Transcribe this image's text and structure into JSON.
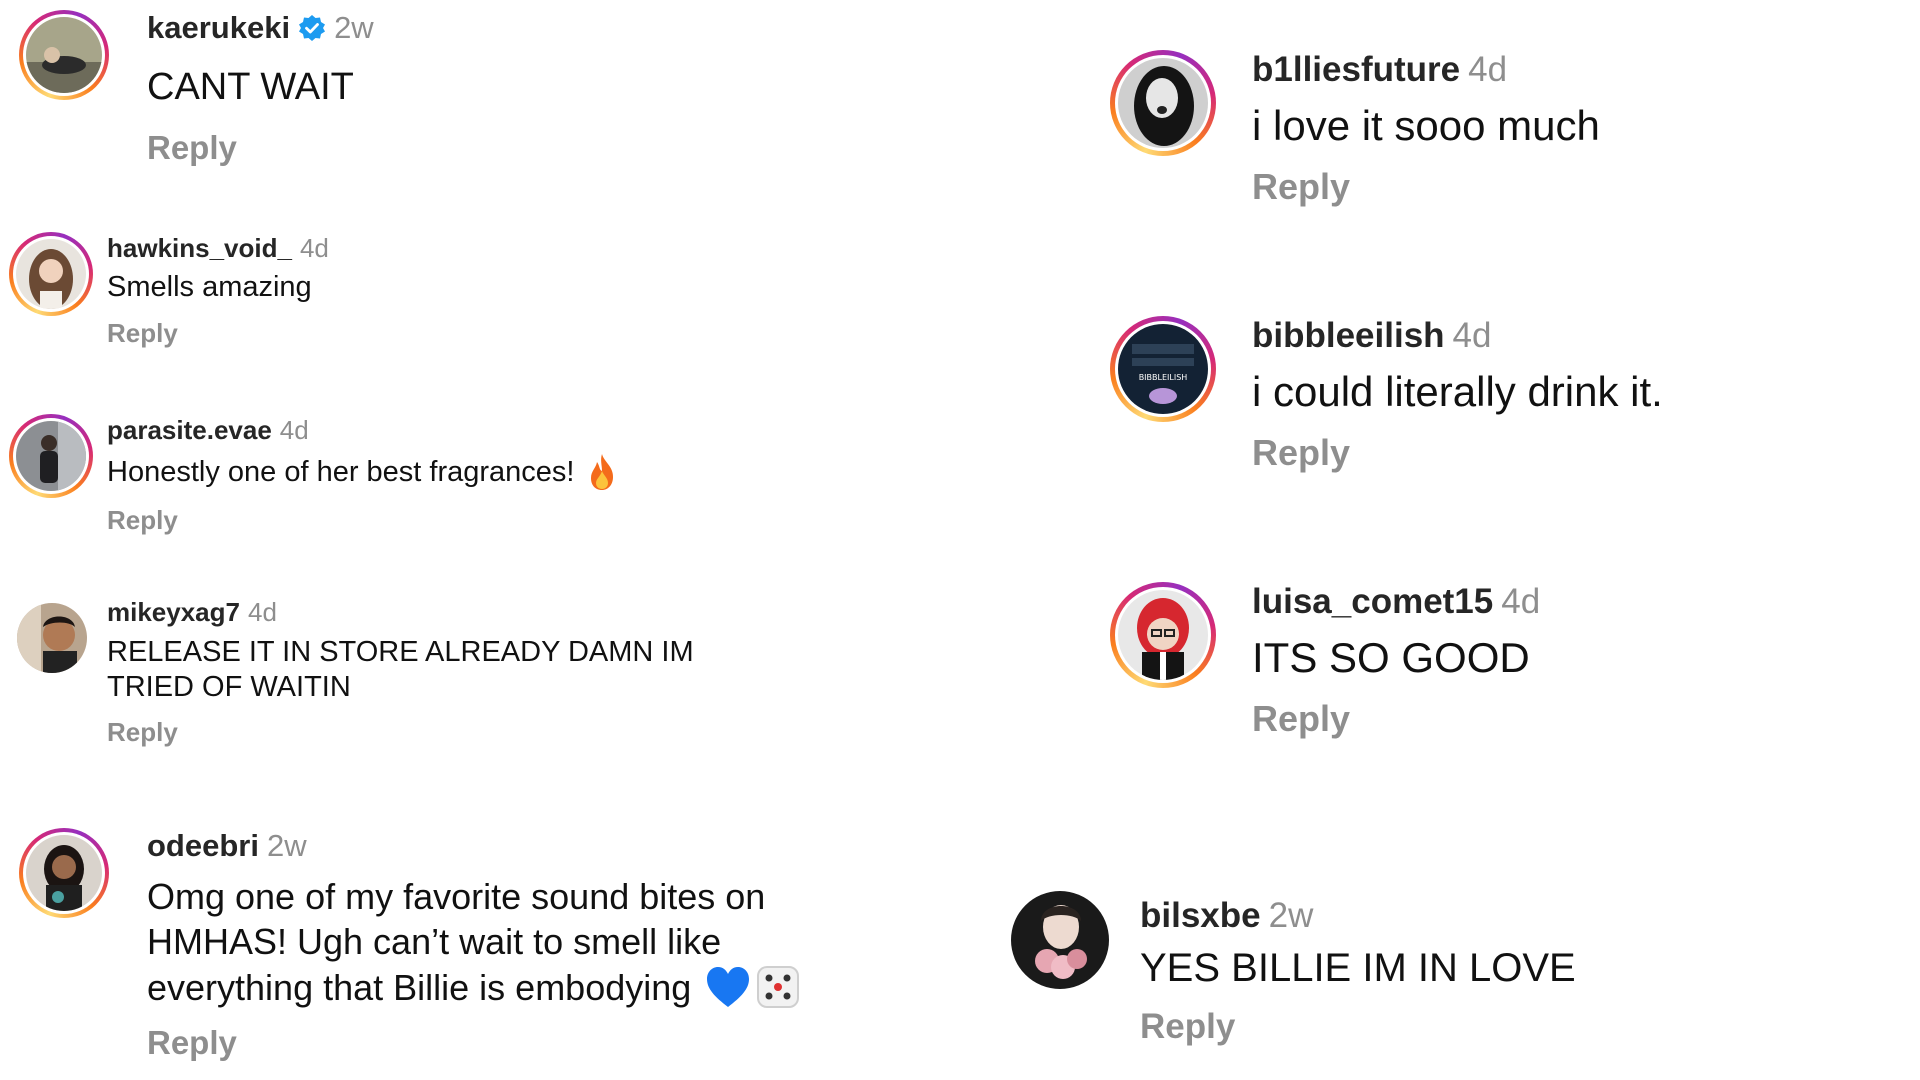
{
  "left": [
    {
      "user": "kaerukeki",
      "verified": true,
      "time": "2w",
      "text": "CANT WAIT",
      "reply": "Reply",
      "avatar": "sleeping-person-avatar"
    },
    {
      "user": "hawkins_void_",
      "verified": false,
      "time": "4d",
      "text": "Smells amazing",
      "reply": "Reply",
      "avatar": "long-hair-woman-avatar"
    },
    {
      "user": "parasite.evae",
      "verified": false,
      "time": "4d",
      "text": "Honestly one of her best fragrances!",
      "emoji": "fire",
      "reply": "Reply",
      "avatar": "standing-person-avatar"
    },
    {
      "user": "mikeyxag7",
      "verified": false,
      "time": "4d",
      "text_line1": "RELEASE IT IN STORE ALREADY DAMN IM",
      "text_line2": "TRIED OF WAITIN",
      "reply": "Reply",
      "avatar": "young-man-avatar"
    },
    {
      "user": "odeebri",
      "verified": false,
      "time": "2w",
      "text_line1": "Omg one of my favorite sound bites on",
      "text_line2": "HMHAS! Ugh can’t wait to smell like",
      "text_line3": "everything that Billie is embodying",
      "emoji": "blue-heart + dice",
      "reply": "Reply",
      "avatar": "woman-portrait-avatar"
    }
  ],
  "right": [
    {
      "user": "b1lliesfuture",
      "verified": false,
      "time": "4d",
      "text": "i love it sooo much",
      "reply": "Reply",
      "avatar": "bw-portrait-avatar"
    },
    {
      "user": "bibbleeilish",
      "verified": false,
      "time": "4d",
      "text": "i could literally drink it.",
      "reply": "Reply",
      "avatar": "bibbleeilish-logo-avatar",
      "avatar_label": "BIBBLEILISH"
    },
    {
      "user": "luisa_comet15",
      "verified": false,
      "time": "4d",
      "text": "ITS SO GOOD",
      "reply": "Reply",
      "avatar": "red-hair-avatar"
    },
    {
      "user": "bilsxbe",
      "verified": false,
      "time": "2w",
      "text": "YES BILLIE IM IN LOVE",
      "reply": "Reply",
      "avatar": "flowers-portrait-avatar"
    }
  ],
  "colors": {
    "username": "#262626",
    "meta": "#8e8e8e",
    "text": "#111111",
    "verified": "#1d9bf0",
    "heart": "#1877f2"
  }
}
